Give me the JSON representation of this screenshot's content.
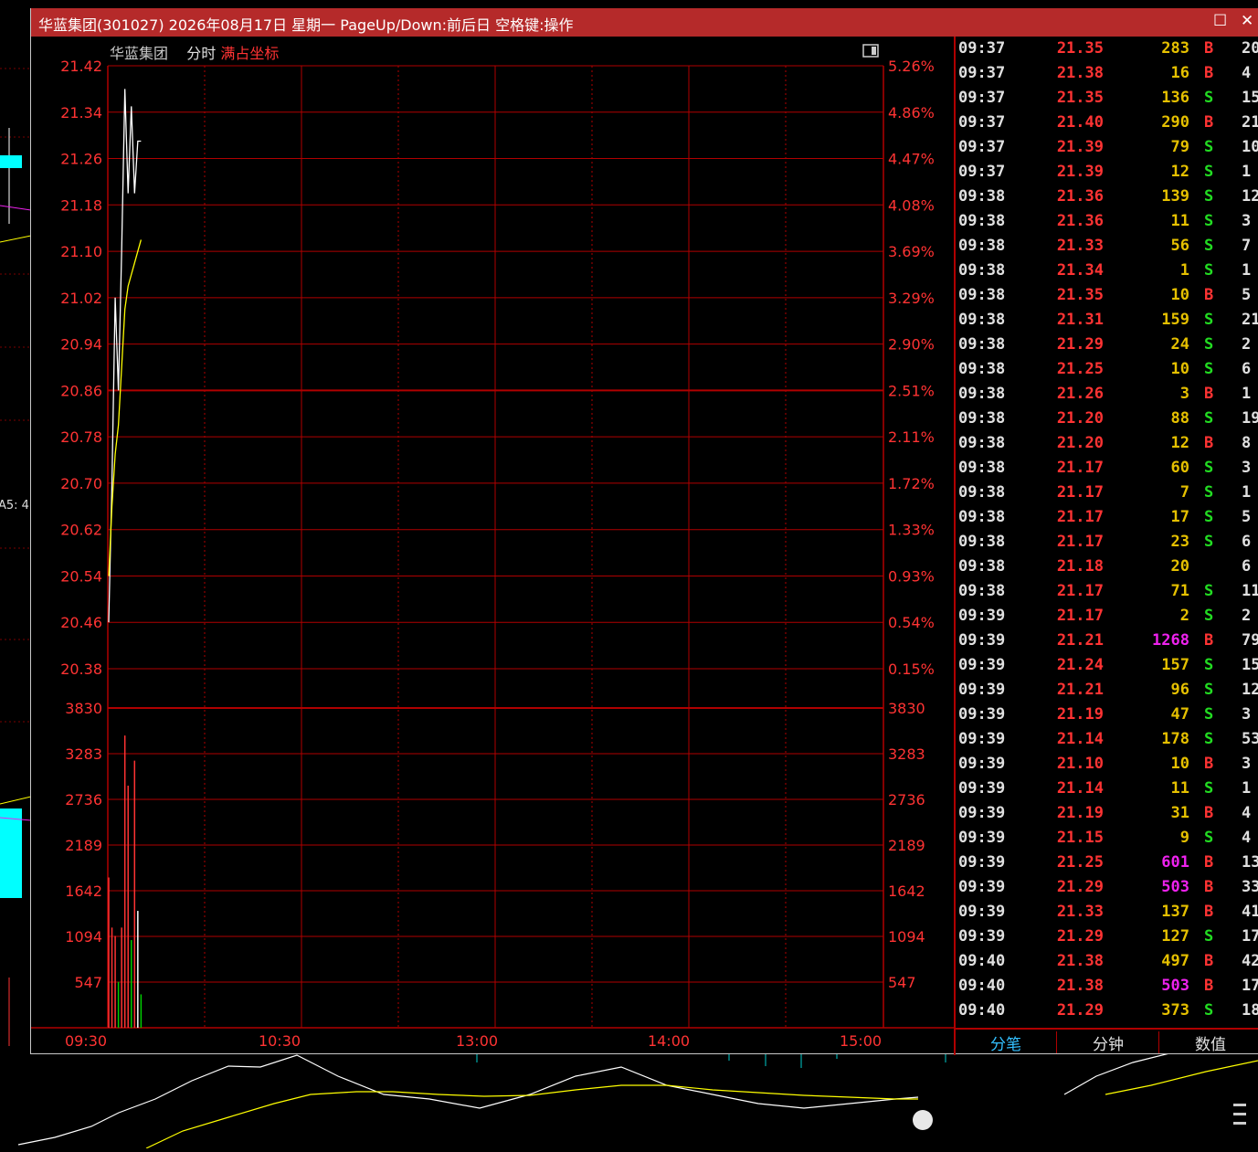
{
  "window": {
    "title": "华蓝集团(301027) 2026年08月17日 星期一 PageUp/Down:前后日 空格键:操作",
    "maximize_icon": "square-icon",
    "close_icon": "close-x-icon"
  },
  "chart_header": {
    "stock_name": "华蓝集团",
    "mode": "分时",
    "scale_mode": "满占坐标",
    "toggle_icon": "panel-toggle-icon"
  },
  "left_background": {
    "label": "A5: 4"
  },
  "chart_data": [
    {
      "type": "line",
      "x": [
        "09:30",
        "09:31",
        "09:32",
        "09:33",
        "09:34",
        "09:35",
        "09:36",
        "09:37",
        "09:38",
        "09:39",
        "09:40"
      ],
      "series": [
        {
          "color": "#ffffff",
          "values": [
            20.46,
            20.7,
            21.02,
            20.86,
            21.1,
            21.38,
            21.2,
            21.35,
            21.2,
            21.29,
            21.29
          ]
        },
        {
          "color": "#ffff00",
          "values": [
            20.54,
            20.66,
            20.75,
            20.8,
            20.9,
            21.0,
            21.04,
            21.06,
            21.08,
            21.1,
            21.12
          ]
        }
      ],
      "ylim": [
        20.38,
        21.42
      ],
      "y_ticks": [
        "21.42",
        "21.34",
        "21.26",
        "21.18",
        "21.10",
        "21.02",
        "20.94",
        "20.86",
        "20.78",
        "20.70",
        "20.62",
        "20.54",
        "20.46",
        "20.38"
      ],
      "pct_ticks": [
        "5.26%",
        "4.86%",
        "4.47%",
        "4.08%",
        "3.69%",
        "3.29%",
        "2.90%",
        "2.51%",
        "2.11%",
        "1.72%",
        "1.33%",
        "0.93%",
        "0.54%",
        "0.15%"
      ],
      "x_ticks": [
        "09:30",
        "10:30",
        "13:00",
        "14:00",
        "15:00"
      ],
      "grid": true
    },
    {
      "type": "bar",
      "x": [
        "09:30",
        "09:31",
        "09:32",
        "09:33",
        "09:34",
        "09:35",
        "09:36",
        "09:37",
        "09:38",
        "09:39",
        "09:40"
      ],
      "values": [
        1800,
        1200,
        1100,
        550,
        1200,
        3500,
        2900,
        1050,
        3200,
        1400,
        400
      ],
      "colors": [
        "#ff3333",
        "#ff3333",
        "#ff3333",
        "#00cc00",
        "#ff3333",
        "#ff3333",
        "#ff3333",
        "#00cc00",
        "#ff3333",
        "#ffffff",
        "#00cc00"
      ],
      "ylim": [
        0,
        3830
      ],
      "y_ticks": [
        "3830",
        "3283",
        "2736",
        "2189",
        "1642",
        "1094",
        "547"
      ],
      "grid": true
    }
  ],
  "ticks": [
    {
      "time": "09:37",
      "price": "21.35",
      "vol": "283",
      "side": "B",
      "num": "20"
    },
    {
      "time": "09:37",
      "price": "21.38",
      "vol": "16",
      "side": "B",
      "num": "4"
    },
    {
      "time": "09:37",
      "price": "21.35",
      "vol": "136",
      "side": "S",
      "num": "15"
    },
    {
      "time": "09:37",
      "price": "21.40",
      "vol": "290",
      "side": "B",
      "num": "21"
    },
    {
      "time": "09:37",
      "price": "21.39",
      "vol": "79",
      "side": "S",
      "num": "10"
    },
    {
      "time": "09:37",
      "price": "21.39",
      "vol": "12",
      "side": "S",
      "num": "1"
    },
    {
      "time": "09:38",
      "price": "21.36",
      "vol": "139",
      "side": "S",
      "num": "12"
    },
    {
      "time": "09:38",
      "price": "21.36",
      "vol": "11",
      "side": "S",
      "num": "3"
    },
    {
      "time": "09:38",
      "price": "21.33",
      "vol": "56",
      "side": "S",
      "num": "7"
    },
    {
      "time": "09:38",
      "price": "21.34",
      "vol": "1",
      "side": "S",
      "num": "1"
    },
    {
      "time": "09:38",
      "price": "21.35",
      "vol": "10",
      "side": "B",
      "num": "5"
    },
    {
      "time": "09:38",
      "price": "21.31",
      "vol": "159",
      "side": "S",
      "num": "21"
    },
    {
      "time": "09:38",
      "price": "21.29",
      "vol": "24",
      "side": "S",
      "num": "2"
    },
    {
      "time": "09:38",
      "price": "21.25",
      "vol": "10",
      "side": "S",
      "num": "6"
    },
    {
      "time": "09:38",
      "price": "21.26",
      "vol": "3",
      "side": "B",
      "num": "1"
    },
    {
      "time": "09:38",
      "price": "21.20",
      "vol": "88",
      "side": "S",
      "num": "19"
    },
    {
      "time": "09:38",
      "price": "21.20",
      "vol": "12",
      "side": "B",
      "num": "8"
    },
    {
      "time": "09:38",
      "price": "21.17",
      "vol": "60",
      "side": "S",
      "num": "3"
    },
    {
      "time": "09:38",
      "price": "21.17",
      "vol": "7",
      "side": "S",
      "num": "1"
    },
    {
      "time": "09:38",
      "price": "21.17",
      "vol": "17",
      "side": "S",
      "num": "5"
    },
    {
      "time": "09:38",
      "price": "21.17",
      "vol": "23",
      "side": "S",
      "num": "6"
    },
    {
      "time": "09:38",
      "price": "21.18",
      "vol": "20",
      "side": "",
      "num": "6"
    },
    {
      "time": "09:38",
      "price": "21.17",
      "vol": "71",
      "side": "S",
      "num": "11"
    },
    {
      "time": "09:39",
      "price": "21.17",
      "vol": "2",
      "side": "S",
      "num": "2"
    },
    {
      "time": "09:39",
      "price": "21.21",
      "vol": "1268",
      "side": "B",
      "num": "79"
    },
    {
      "time": "09:39",
      "price": "21.24",
      "vol": "157",
      "side": "S",
      "num": "15"
    },
    {
      "time": "09:39",
      "price": "21.21",
      "vol": "96",
      "side": "S",
      "num": "12"
    },
    {
      "time": "09:39",
      "price": "21.19",
      "vol": "47",
      "side": "S",
      "num": "3"
    },
    {
      "time": "09:39",
      "price": "21.14",
      "vol": "178",
      "side": "S",
      "num": "53"
    },
    {
      "time": "09:39",
      "price": "21.10",
      "vol": "10",
      "side": "B",
      "num": "3"
    },
    {
      "time": "09:39",
      "price": "21.14",
      "vol": "11",
      "side": "S",
      "num": "1"
    },
    {
      "time": "09:39",
      "price": "21.19",
      "vol": "31",
      "side": "B",
      "num": "4"
    },
    {
      "time": "09:39",
      "price": "21.15",
      "vol": "9",
      "side": "S",
      "num": "4"
    },
    {
      "time": "09:39",
      "price": "21.25",
      "vol": "601",
      "side": "B",
      "num": "13"
    },
    {
      "time": "09:39",
      "price": "21.29",
      "vol": "503",
      "side": "B",
      "num": "33"
    },
    {
      "time": "09:39",
      "price": "21.33",
      "vol": "137",
      "side": "B",
      "num": "41"
    },
    {
      "time": "09:39",
      "price": "21.29",
      "vol": "127",
      "side": "S",
      "num": "17"
    },
    {
      "time": "09:40",
      "price": "21.38",
      "vol": "497",
      "side": "B",
      "num": "42"
    },
    {
      "time": "09:40",
      "price": "21.38",
      "vol": "503",
      "side": "B",
      "num": "17"
    },
    {
      "time": "09:40",
      "price": "21.29",
      "vol": "373",
      "side": "S",
      "num": "18"
    }
  ],
  "colors": {
    "buy": "#ff3333",
    "sell": "#22dd22",
    "big_volume": "#ee22ee",
    "volume": "#e5c000",
    "grid": "#b00000",
    "title_bar": "#b52a2a"
  },
  "tabs": [
    {
      "label": "分笔",
      "active": true
    },
    {
      "label": "分钟",
      "active": false
    },
    {
      "label": "数值",
      "active": false
    }
  ]
}
